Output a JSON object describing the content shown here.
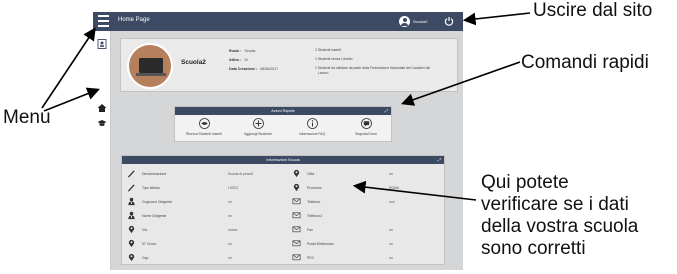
{
  "app": {
    "title": "Home Page",
    "username": "Scuola2",
    "icons": {
      "menu": "hamburger-icon",
      "user": "user-circle-icon",
      "logout": "power-icon",
      "side1": "id-card-icon",
      "side2": "home-icon",
      "side3": "graduation-cap-icon"
    }
  },
  "profile": {
    "school_name": "Scuola2",
    "fields": [
      {
        "label": "Ruolo :",
        "value": "Scuola"
      },
      {
        "label": "Attivo :",
        "value": "Si"
      },
      {
        "label": "Data Creazione :",
        "value": "08/06/2017"
      }
    ],
    "notes": [
      "2 Studenti inseriti",
      "1 Studenti senza Libretto",
      "1 Studenti da validare da parte della Federazione Nazionale dei Cavalieri del",
      "Lavoro"
    ]
  },
  "quick_actions": {
    "title": "Azioni Rapide",
    "items": [
      {
        "label": "Ricerca Studenti Inseriti",
        "icon": "eye-icon"
      },
      {
        "label": "Aggiungi Studente",
        "icon": "plus-circle-icon"
      },
      {
        "label": "Informazioni FAQ",
        "icon": "info-icon"
      },
      {
        "label": "Segnala Errori",
        "icon": "message-icon"
      }
    ]
  },
  "school_info": {
    "title": "Informazioni Scuola",
    "left": [
      {
        "label": "Denominazione",
        "value": "Scuola di prova2",
        "icon": "pen-icon"
      },
      {
        "label": "Tipo Istituto",
        "value": "LICEO",
        "icon": "pen-icon"
      },
      {
        "label": "Cognome Dirigente",
        "value": "nn",
        "icon": "person-icon"
      },
      {
        "label": "Nome Dirigente",
        "value": "nn",
        "icon": "person-icon"
      },
      {
        "label": "Via",
        "value": "nnnnn",
        "icon": "pin-icon"
      },
      {
        "label": "N° Civico",
        "value": "nn",
        "icon": "pin-icon"
      },
      {
        "label": "Cap",
        "value": "nn",
        "icon": "pin-icon"
      }
    ],
    "right": [
      {
        "label": "Città",
        "value": "nn",
        "icon": "pin-icon"
      },
      {
        "label": "Provincia",
        "value": "ROMA",
        "icon": "pin-icon"
      },
      {
        "label": "Telefono",
        "value": "nnn",
        "icon": "envelope-icon"
      },
      {
        "label": "Telefono2",
        "value": "",
        "icon": "envelope-icon"
      },
      {
        "label": "Fax",
        "value": "nn",
        "icon": "envelope-icon"
      },
      {
        "label": "Posta Elettronica",
        "value": "nn",
        "icon": "envelope-icon"
      },
      {
        "label": "PEC",
        "value": "nn",
        "icon": "envelope-icon"
      }
    ]
  },
  "annotations": {
    "logout": "Uscire dal sito",
    "quick": "Comandi rapidi",
    "menu": "Menu",
    "verify": [
      "Qui potete",
      "verificare se i dati",
      "della vostra scuola",
      "sono corretti"
    ]
  }
}
